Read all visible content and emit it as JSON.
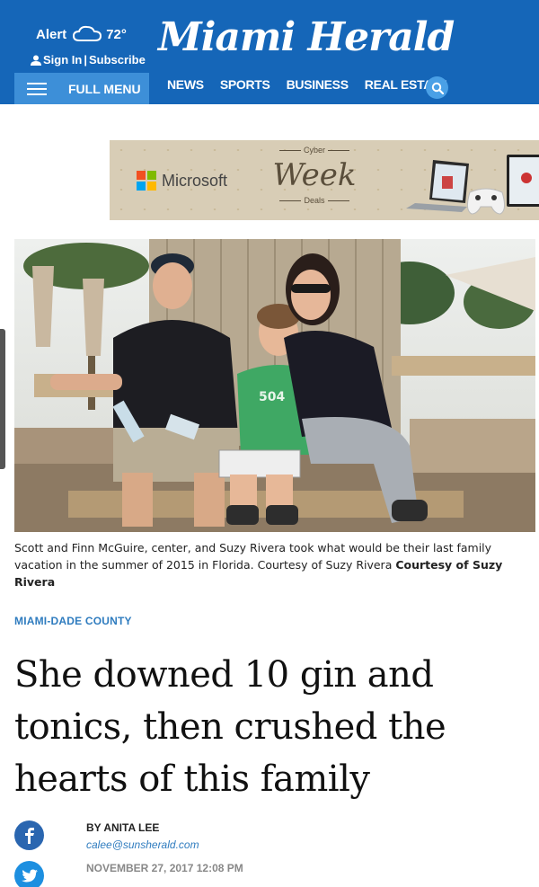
{
  "header": {
    "alert_label": "Alert",
    "temperature": "72°",
    "sign_in": "Sign In",
    "subscribe": "Subscribe",
    "logo_text": "Miami Herald",
    "full_menu": "FULL MENU",
    "nav_items": [
      "NEWS",
      "SPORTS",
      "BUSINESS",
      "REAL ESTATE"
    ],
    "brand_color": "#1566b8"
  },
  "ad": {
    "brand": "Microsoft",
    "promo_top": "Cyber",
    "promo_main": "Week",
    "promo_bottom": "Deals"
  },
  "photo": {
    "jersey_text": "504"
  },
  "caption": {
    "text": "Scott and Finn McGuire, center, and Suzy Rivera took what would be their last family vacation in the summer of 2015 in Florida. Courtesy of Suzy Rivera ",
    "credit": "Courtesy of Suzy Rivera"
  },
  "article": {
    "section": "MIAMI-DADE COUNTY",
    "headline": "She downed 10 gin and tonics, then crushed the hearts of this family",
    "byline": "BY ANITA LEE",
    "email": "calee@sunsherald.com",
    "date": "NOVEMBER 27, 2017 12:08 PM"
  },
  "icons": [
    "cloud-icon",
    "user-icon",
    "search-icon",
    "facebook-icon",
    "twitter-icon",
    "menu-icon"
  ]
}
